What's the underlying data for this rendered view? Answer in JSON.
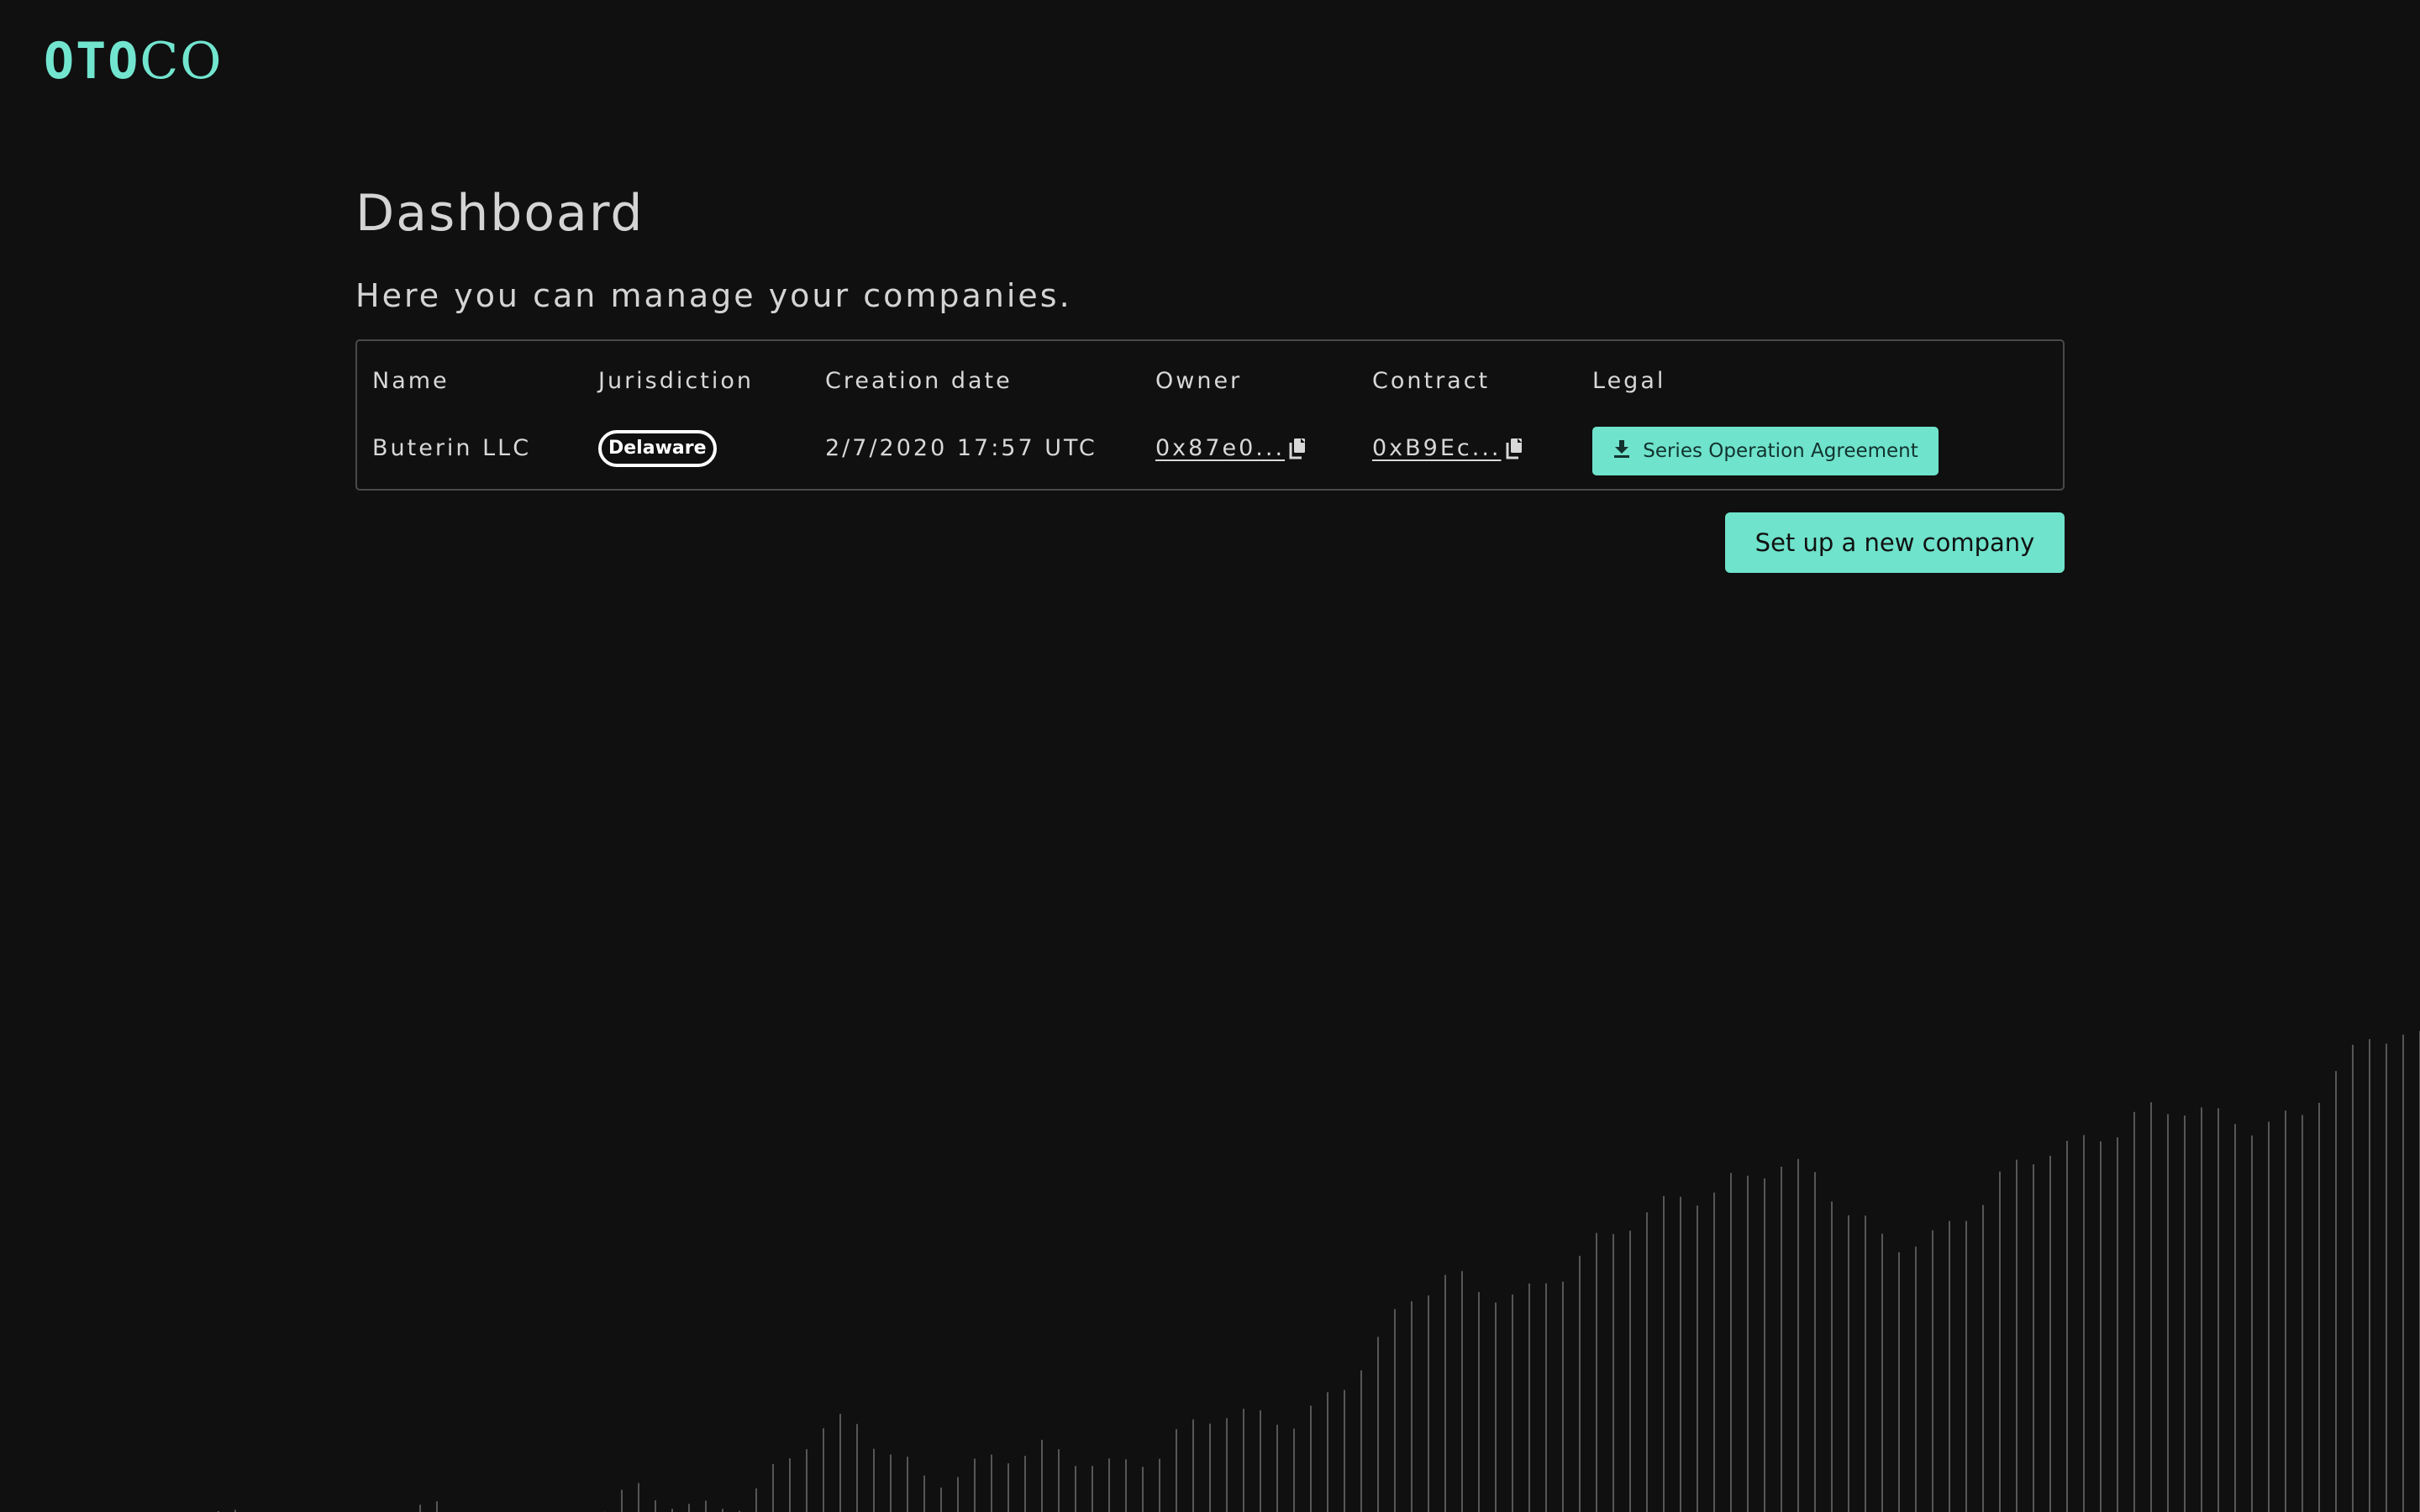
{
  "brand": {
    "logo_left": "OTO",
    "logo_right": "CO",
    "accent_color": "#6fe3cc"
  },
  "page": {
    "title": "Dashboard",
    "subtitle": "Here you can manage your companies."
  },
  "table": {
    "columns": [
      "Name",
      "Jurisdiction",
      "Creation date",
      "Owner",
      "Contract",
      "Legal"
    ],
    "rows": [
      {
        "name": "Buterin LLC",
        "jurisdiction": "Delaware",
        "creation_date": "2/7/2020 17:57 UTC",
        "owner": "0x87e0...",
        "contract": "0xB9Ec...",
        "legal_label": "Series Operation Agreement",
        "legal_icon": "download-icon",
        "copy_icon": "copy-icon"
      }
    ]
  },
  "actions": {
    "new_company_label": "Set up a new company"
  },
  "background": {
    "decoration": "wireframe-terrain"
  }
}
